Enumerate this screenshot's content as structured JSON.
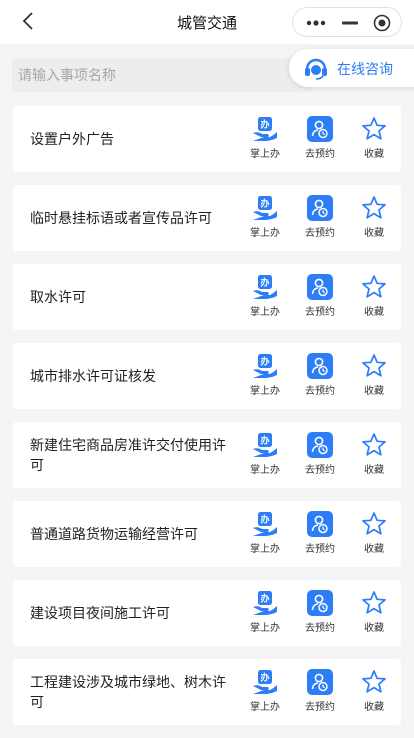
{
  "header": {
    "title": "城管交通",
    "back_icon": "chevron-left-icon",
    "capsule_icons": [
      "more-dots-icon",
      "minimize-icon",
      "record-icon"
    ]
  },
  "search": {
    "placeholder": "请输入事项名称",
    "value": ""
  },
  "consult": {
    "label": "在线咨询",
    "icon": "headset-icon"
  },
  "colors": {
    "accent": "#2d7df6",
    "background": "#f4f5f7"
  },
  "items": [
    {
      "title": "设置户外广告",
      "actions": {
        "handle": "掌上办",
        "book": "去预约",
        "fav": "收藏"
      }
    },
    {
      "title": "临时悬挂标语或者宣传品许可",
      "actions": {
        "handle": "掌上办",
        "book": "去预约",
        "fav": "收藏"
      }
    },
    {
      "title": "取水许可",
      "actions": {
        "handle": "掌上办",
        "book": "去预约",
        "fav": "收藏"
      }
    },
    {
      "title": "城市排水许可证核发",
      "actions": {
        "handle": "掌上办",
        "book": "去预约",
        "fav": "收藏"
      }
    },
    {
      "title": "新建住宅商品房准许交付使用许可",
      "actions": {
        "handle": "掌上办",
        "book": "去预约",
        "fav": "收藏"
      }
    },
    {
      "title": "普通道路货物运输经营许可",
      "actions": {
        "handle": "掌上办",
        "book": "去预约",
        "fav": "收藏"
      }
    },
    {
      "title": "建设项目夜间施工许可",
      "actions": {
        "handle": "掌上办",
        "book": "去预约",
        "fav": "收藏"
      }
    },
    {
      "title": "工程建设涉及城市绿地、树木许可",
      "actions": {
        "handle": "掌上办",
        "book": "去预约",
        "fav": "收藏"
      }
    }
  ]
}
